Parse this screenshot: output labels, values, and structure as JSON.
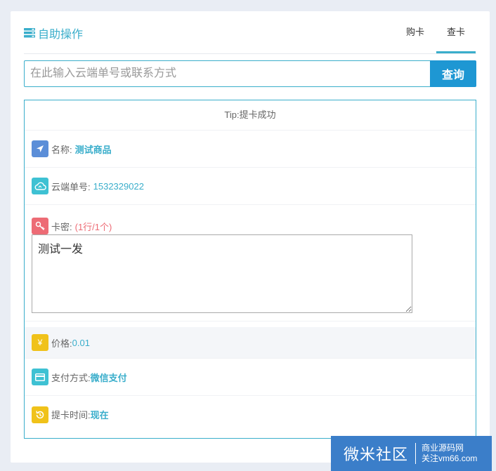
{
  "header": {
    "title": "自助操作",
    "tabs": [
      {
        "label": "购卡",
        "active": false
      },
      {
        "label": "查卡",
        "active": true
      }
    ]
  },
  "search": {
    "placeholder": "在此输入云端单号或联系方式",
    "button_label": "查询"
  },
  "result": {
    "tip": "Tip:提卡成功",
    "name_label": "名称:",
    "name_value": "测试商品",
    "order_label": "云端单号:",
    "order_value": "1532329022",
    "key_label": "卡密:",
    "key_count": "(1行/1个)",
    "key_content": "测试一发",
    "price_label": "价格:",
    "price_value": "0.01",
    "price_icon": "¥",
    "pay_label": "支付方式:",
    "pay_value": "微信支付",
    "time_label": "提卡时间:",
    "time_value": "现在"
  },
  "watermark": {
    "main": "微米社区",
    "sub1": "商业源码网",
    "sub2": "关注vm66.com"
  },
  "colors": {
    "accent": "#3aaecb",
    "button": "#1e97d3",
    "key_red": "#ed6b75"
  }
}
